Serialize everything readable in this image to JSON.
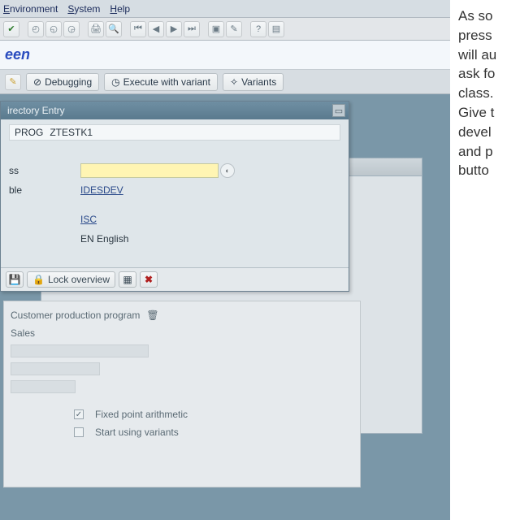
{
  "menu": {
    "items": [
      "Environment",
      "System",
      "Help"
    ]
  },
  "title_suffix": "een",
  "app_toolbar": {
    "debug": "Debugging",
    "exec_variant": "Execute with variant",
    "variants": "Variants"
  },
  "modal": {
    "title": "irectory Entry",
    "object_type": "PROG",
    "object_name": "ZTESTK1",
    "label_class": "ss",
    "label_responsible": "ble",
    "responsible_value": "IDESDEV",
    "author_value": "ISC",
    "lang_value": "EN English",
    "lock_overview": "Lock overview"
  },
  "inner": {
    "line1": "Customer production program",
    "line2": "Sales",
    "fixed_point": "Fixed point arithmetic",
    "start_variants": "Start using variants"
  },
  "side": {
    "l1": "As so",
    "l2": "press",
    "l3": "will au",
    "l4": "ask fo",
    "l5": "class.",
    "l6": "Give t",
    "l7": "devel",
    "l8": "and p",
    "l9": "butto"
  }
}
